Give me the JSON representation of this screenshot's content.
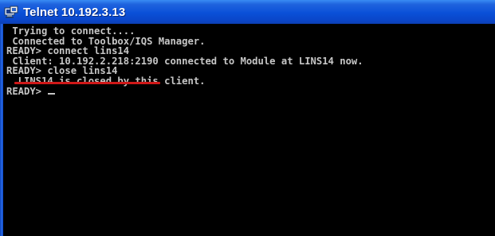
{
  "window": {
    "title": "Telnet 10.192.3.13",
    "icon": "telnet-icon"
  },
  "console": {
    "lines": [
      " Trying to connect....",
      " Connected to Toolbox/IQS Manager.",
      "READY> connect lins14",
      " Client: 10.192.2.218:2190 connected to Module at LINS14 now.",
      "READY> close lins14",
      "  LINS14 is closed by this client.",
      "READY> "
    ],
    "text_color": "#c6c6c6",
    "background_color": "#000000",
    "annotation_color": "#d01818"
  }
}
